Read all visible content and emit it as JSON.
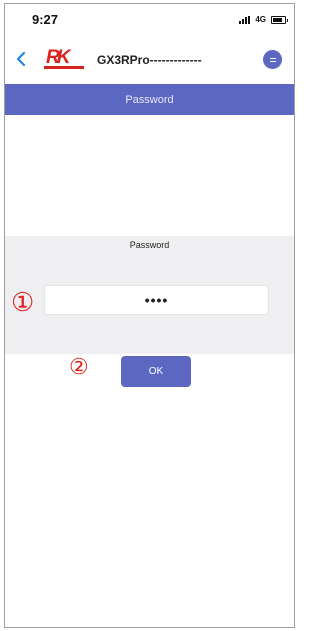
{
  "status_bar": {
    "time": "9:27",
    "network": "4G"
  },
  "header": {
    "logo_icon": "brand-logo",
    "device_name": "GX3RPro-------------",
    "back_icon": "chevron-left-icon",
    "menu_icon": "menu-icon"
  },
  "title_bar": {
    "title": "Password"
  },
  "password_form": {
    "label": "Password",
    "value": "••••",
    "ok_label": "OK"
  },
  "annotations": {
    "marker_1": "①",
    "marker_2": "②"
  },
  "colors": {
    "accent": "#5c67c2",
    "panel_bg": "#efeff1",
    "annotation_red": "#e0201a",
    "logo_red": "#d8241c",
    "back_arrow": "#1e88e5"
  }
}
